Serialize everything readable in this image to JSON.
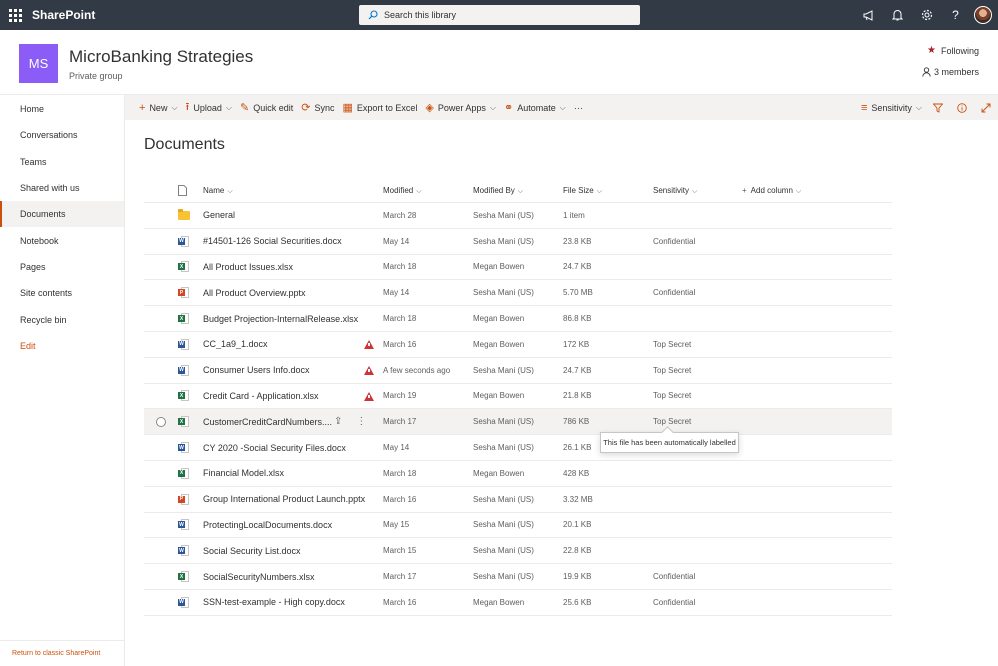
{
  "suite": {
    "brand": "SharePoint",
    "search_placeholder": "Search this library"
  },
  "site": {
    "logo_text": "MS",
    "title": "MicroBanking Strategies",
    "subtitle": "Private group",
    "following": "Following",
    "members": "3 members"
  },
  "nav": {
    "items": [
      "Home",
      "Conversations",
      "Teams",
      "Shared with us",
      "Documents",
      "Notebook",
      "Pages",
      "Site contents",
      "Recycle bin"
    ],
    "active": "Documents",
    "edit": "Edit",
    "classic": "Return to classic SharePoint"
  },
  "commands": {
    "new": "New",
    "upload": "Upload",
    "quick_edit": "Quick edit",
    "sync": "Sync",
    "export": "Export to Excel",
    "power_apps": "Power Apps",
    "automate": "Automate",
    "more": "···",
    "sensitivity": "Sensitivity"
  },
  "library": {
    "title": "Documents",
    "columns": {
      "name": "Name",
      "modified": "Modified",
      "modified_by": "Modified By",
      "file_size": "File Size",
      "sensitivity": "Sensitivity",
      "add_column": "Add column"
    },
    "rows": [
      {
        "name": "General",
        "type": "folder",
        "modified": "March 28",
        "by": "Sesha Mani (US)",
        "size": "1 item",
        "sensitivity": ""
      },
      {
        "name": "#14501-126 Social Securities.docx",
        "type": "word",
        "modified": "May 14",
        "by": "Sesha Mani (US)",
        "size": "23.8 KB",
        "sensitivity": "Confidential"
      },
      {
        "name": "All Product Issues.xlsx",
        "type": "excel",
        "modified": "March 18",
        "by": "Megan Bowen",
        "size": "24.7 KB",
        "sensitivity": ""
      },
      {
        "name": "All Product Overview.pptx",
        "type": "ppt",
        "modified": "May 14",
        "by": "Sesha Mani (US)",
        "size": "5.70 MB",
        "sensitivity": "Confidential"
      },
      {
        "name": "Budget Projection-InternalRelease.xlsx",
        "type": "excel",
        "modified": "March 18",
        "by": "Megan Bowen",
        "size": "86.8 KB",
        "sensitivity": ""
      },
      {
        "name": "CC_1a9_1.docx",
        "type": "word",
        "modified": "March 16",
        "by": "Megan Bowen",
        "size": "172 KB",
        "sensitivity": "Top Secret",
        "warning": true
      },
      {
        "name": "Consumer Users Info.docx",
        "type": "word",
        "modified": "A few seconds ago",
        "by": "Sesha Mani (US)",
        "size": "24.7 KB",
        "sensitivity": "Top Secret",
        "warning": true
      },
      {
        "name": "Credit Card - Application.xlsx",
        "type": "excel",
        "modified": "March 19",
        "by": "Megan Bowen",
        "size": "21.8 KB",
        "sensitivity": "Top Secret",
        "warning": true
      },
      {
        "name": "CustomerCreditCardNumbers....",
        "type": "excel",
        "modified": "March 17",
        "by": "Sesha Mani (US)",
        "size": "786 KB",
        "sensitivity": "Top Secret",
        "selected": true
      },
      {
        "name": "CY 2020 -Social Security Files.docx",
        "type": "word",
        "modified": "May 14",
        "by": "Sesha Mani (US)",
        "size": "26.1 KB",
        "sensitivity": ""
      },
      {
        "name": "Financial Model.xlsx",
        "type": "excel",
        "modified": "March 18",
        "by": "Megan Bowen",
        "size": "428 KB",
        "sensitivity": ""
      },
      {
        "name": "Group International Product Launch.pptx",
        "type": "ppt",
        "modified": "March 16",
        "by": "Sesha Mani (US)",
        "size": "3.32 MB",
        "sensitivity": ""
      },
      {
        "name": "ProtectingLocalDocuments.docx",
        "type": "word",
        "modified": "May 15",
        "by": "Sesha Mani (US)",
        "size": "20.1 KB",
        "sensitivity": ""
      },
      {
        "name": "Social Security List.docx",
        "type": "word",
        "modified": "March 15",
        "by": "Sesha Mani (US)",
        "size": "22.8 KB",
        "sensitivity": ""
      },
      {
        "name": "SocialSecurityNumbers.xlsx",
        "type": "excel",
        "modified": "March 17",
        "by": "Sesha Mani (US)",
        "size": "19.9 KB",
        "sensitivity": "Confidential"
      },
      {
        "name": "SSN-test-example - High copy.docx",
        "type": "word",
        "modified": "March 16",
        "by": "Megan Bowen",
        "size": "25.6 KB",
        "sensitivity": "Confidential"
      }
    ],
    "tooltip": "This file has been automatically labelled"
  },
  "colors": {
    "suitebar": "#323a45",
    "accent": "#ca5010",
    "logo": "#8b5cf6",
    "warning": "#d13438"
  }
}
